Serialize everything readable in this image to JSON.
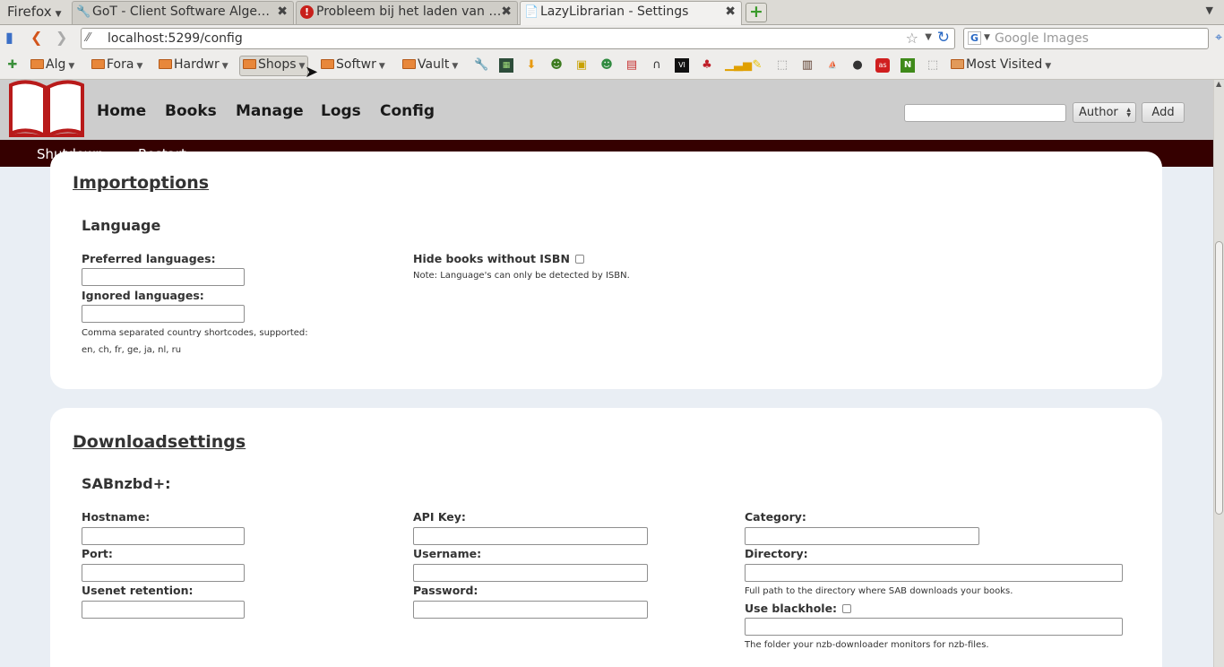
{
  "browser": {
    "menu_label": "Firefox",
    "tabs": [
      {
        "title": "GoT - Client Software Alge…"
      },
      {
        "title": "Probleem bij het laden van …"
      },
      {
        "title": "LazyLibrarian - Settings"
      }
    ],
    "url": "localhost:5299/config",
    "search_placeholder": "Google Images",
    "bookmarks": [
      {
        "label": "Alg"
      },
      {
        "label": "Fora"
      },
      {
        "label": "Hardwr"
      },
      {
        "label": "Shops"
      },
      {
        "label": "Softwr"
      },
      {
        "label": "Vault"
      },
      {
        "label": "Most Visited"
      }
    ]
  },
  "app": {
    "nav": {
      "home": "Home",
      "books": "Books",
      "manage": "Manage",
      "logs": "Logs",
      "config": "Config"
    },
    "search_type": "Author",
    "add_label": "Add",
    "subnav": {
      "shutdown": "Shutdown",
      "restart": "Restart"
    }
  },
  "import_options": {
    "title": "Importoptions",
    "language_heading": "Language",
    "preferred_label": "Preferred languages:",
    "ignored_label": "Ignored languages:",
    "shortcodes_note_1": "Comma separated country shortcodes, supported:",
    "shortcodes_note_2": "en, ch, fr, ge, ja, nl, ru",
    "hide_isbn_label": "Hide books without ISBN",
    "isbn_note": "Note: Language's can only be detected by ISBN."
  },
  "download_settings": {
    "title": "Downloadsettings",
    "sab_heading": "SABnzbd+:",
    "hostname_label": "Hostname:",
    "port_label": "Port:",
    "retention_label": "Usenet retention:",
    "apikey_label": "API Key:",
    "username_label": "Username:",
    "password_label": "Password:",
    "category_label": "Category:",
    "directory_label": "Directory:",
    "directory_note": "Full path to the directory where SAB downloads your books.",
    "blackhole_label": "Use blackhole:",
    "blackhole_note": "The folder your nzb-downloader monitors for nzb-files."
  },
  "colors": {
    "header_bg": "#cdcdcd",
    "subnav_bg": "#350000",
    "logo_red": "#b81a1a",
    "page_bg": "#e9eef4"
  }
}
